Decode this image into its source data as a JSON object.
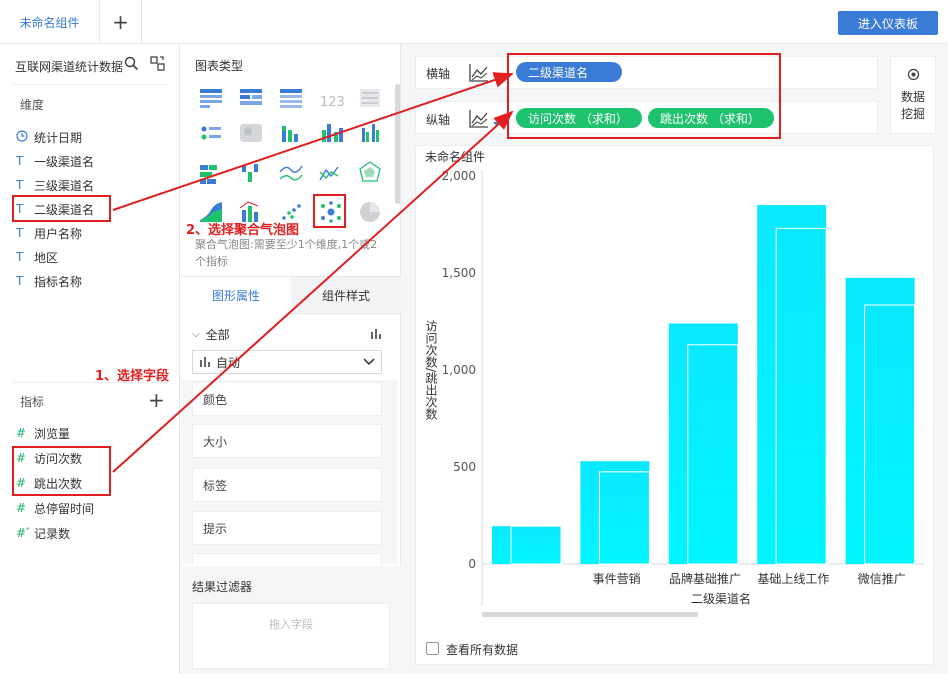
{
  "header": {
    "tab_label": "未命名组件",
    "add_tab": "+",
    "dashboard_button": "进入仪表板"
  },
  "left": {
    "dataset_title": "互联网渠道统计数据",
    "dimension_label": "维度",
    "dimensions": [
      {
        "icon": "clock-icon",
        "label": "统计日期"
      },
      {
        "icon": "text-type-icon",
        "label": "一级渠道名"
      },
      {
        "icon": "text-type-icon",
        "label": "三级渠道名"
      },
      {
        "icon": "text-type-icon",
        "label": "二级渠道名"
      },
      {
        "icon": "text-type-icon",
        "label": "用户名称"
      },
      {
        "icon": "text-type-icon",
        "label": "地区"
      },
      {
        "icon": "text-type-icon",
        "label": "指标名称"
      }
    ],
    "measure_label": "指标",
    "measure_add": "+",
    "measures": [
      {
        "label": "浏览量"
      },
      {
        "label": "访问次数"
      },
      {
        "label": "跳出次数"
      },
      {
        "label": "总停留时间"
      },
      {
        "label": "记录数"
      }
    ]
  },
  "middle": {
    "chart_type_title": "图表类型",
    "chart_desc": "聚合气泡图:需要至少1个维度,1个或2个指标",
    "tabs": [
      "图形属性",
      "组件样式"
    ],
    "all_label": "全部",
    "select_value": "自动",
    "attr_items": [
      "颜色",
      "大小",
      "标签",
      "提示"
    ],
    "filter_title": "结果过滤器",
    "filter_placeholder": "拖入字段"
  },
  "right": {
    "x_axis_label": "横轴",
    "y_axis_label": "纵轴",
    "x_pill": "二级渠道名",
    "y_pills": [
      "访问次数 （求和）",
      "跳出次数 （求和）"
    ],
    "mining_label_1": "数据",
    "mining_label_2": "挖掘",
    "chart_title": "未命名组件",
    "show_all": "查看所有数据"
  },
  "annotations": {
    "step1": "1、选择字段",
    "step2": "2、选择聚合气泡图",
    "accent": "#e02020"
  },
  "colors": {
    "primary": "#3a7bd5",
    "green": "#1ec26e",
    "bar": "#00f0ff"
  },
  "chart_data": {
    "type": "bar",
    "categories": [
      "",
      "事件营销",
      "品牌基础推广",
      "基础上线工作",
      "微信推广"
    ],
    "series": [
      {
        "name": "访问次数",
        "values": [
          195,
          530,
          1240,
          1850,
          1475
        ]
      },
      {
        "name": "跳出次数",
        "values": [
          195,
          475,
          1130,
          1730,
          1335
        ]
      }
    ],
    "xlabel": "二级渠道名",
    "ylabel": "访问次数/跳出次数",
    "yticks": [
      "0",
      "500",
      "1,000",
      "1,500",
      "2,000"
    ],
    "ylim": [
      0,
      2000
    ],
    "grid": true
  }
}
